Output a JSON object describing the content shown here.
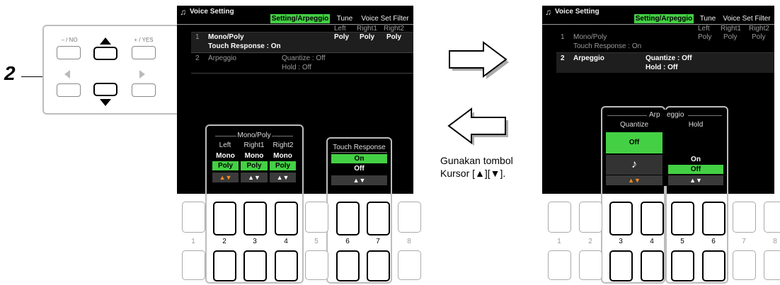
{
  "step_number": "2",
  "caption": {
    "line1": "Gunakan tombol",
    "line2": "Kursor [▲][▼]."
  },
  "left_screen": {
    "title": "Voice Setting",
    "tabs": [
      "Setting/Arpeggio",
      "Tune",
      "Voice Set Filter"
    ],
    "col_headers": [
      "Left",
      "Right1",
      "Right2"
    ],
    "rows": [
      {
        "num": "1",
        "label": "Mono/Poly",
        "values": [
          "Poly",
          "Poly",
          "Poly"
        ]
      },
      {
        "num": "",
        "label": "Touch Response : On"
      },
      {
        "num": "2",
        "label": "Arpeggio",
        "quantize": "Quantize : Off",
        "hold": "Hold : Off"
      }
    ],
    "mono_poly_panel": {
      "title": "Mono/Poly",
      "columns": [
        {
          "label": "Left",
          "options": [
            "Mono",
            "Poly"
          ],
          "selected": 1
        },
        {
          "label": "Right1",
          "options": [
            "Mono",
            "Poly"
          ],
          "selected": 1
        },
        {
          "label": "Right2",
          "options": [
            "Mono",
            "Poly"
          ],
          "selected": 1
        }
      ]
    },
    "touch_panel": {
      "title": "Touch Response",
      "options": [
        "On",
        "Off"
      ],
      "selected": 0
    }
  },
  "right_screen": {
    "title": "Voice Setting",
    "tabs": [
      "Setting/Arpeggio",
      "Tune",
      "Voice Set Filter"
    ],
    "col_headers": [
      "Left",
      "Right1",
      "Right2"
    ],
    "rows": [
      {
        "num": "1",
        "label": "Mono/Poly",
        "values": [
          "Poly",
          "Poly",
          "Poly"
        ]
      },
      {
        "num": "",
        "label": "Touch Response : On"
      },
      {
        "num": "2",
        "label": "Arpeggio",
        "quantize": "Quantize : Off",
        "hold": "Hold : Off"
      }
    ],
    "arpeggio_panel": {
      "title_left": "Arp",
      "title_right": "eggio",
      "quantize": {
        "label": "Quantize",
        "value": "Off",
        "note": "♪"
      },
      "hold": {
        "label": "Hold",
        "options": [
          "On",
          "Off"
        ],
        "selected": 1
      }
    }
  },
  "button_numbers": [
    "1",
    "2",
    "3",
    "4",
    "5",
    "6",
    "7",
    "8"
  ],
  "right_button_numbers": [
    "1",
    "2",
    "3",
    "4",
    "5",
    "6",
    "7",
    "8"
  ],
  "cursor_pad": {
    "no_label": "– / NO",
    "yes_label": "+ / YES"
  },
  "arrows": {
    "up_down": "▲▼"
  }
}
